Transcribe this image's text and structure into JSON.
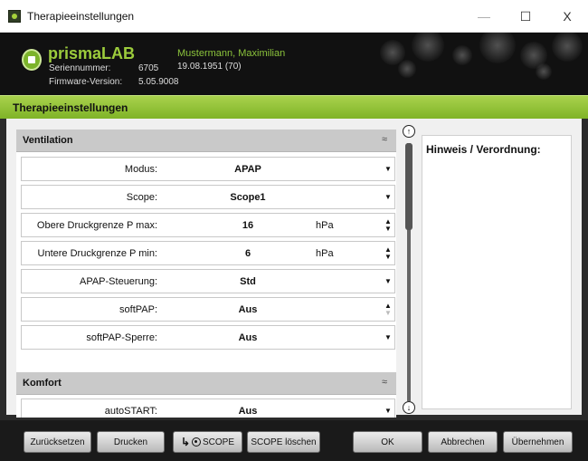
{
  "window": {
    "title": "Therapieeinstellungen",
    "min_glyph": "—",
    "max_glyph": "☐",
    "close_glyph": "X"
  },
  "header": {
    "brand": "prismaLAB",
    "serial_label": "Seriennummer:",
    "serial_value": "6705",
    "firmware_label": "Firmware-Version:",
    "firmware_value": "5.05.9008",
    "patient_name": "Mustermann, Maximilian",
    "patient_dob": "19.08.1951  (70)"
  },
  "section": {
    "title": "Therapieeinstellungen"
  },
  "groups": [
    {
      "title": "Ventilation",
      "collapse_glyph": "≈"
    },
    {
      "title": "Komfort",
      "collapse_glyph": "≈"
    }
  ],
  "rows": [
    {
      "label": "Modus:",
      "value": "APAP",
      "unit": "",
      "control": "dropdown"
    },
    {
      "label": "Scope:",
      "value": "Scope1",
      "unit": "",
      "control": "dropdown"
    },
    {
      "label": "Obere Druckgrenze P max:",
      "value": "16",
      "unit": "hPa",
      "control": "spinner"
    },
    {
      "label": "Untere Druckgrenze P min:",
      "value": "6",
      "unit": "hPa",
      "control": "spinner"
    },
    {
      "label": "APAP-Steuerung:",
      "value": "Std",
      "unit": "",
      "control": "dropdown"
    },
    {
      "label": "softPAP:",
      "value": "Aus",
      "unit": "",
      "control": "spinner"
    },
    {
      "label": "softPAP-Sperre:",
      "value": "Aus",
      "unit": "",
      "control": "dropdown"
    },
    {
      "label": "autoSTART:",
      "value": "Aus",
      "unit": "",
      "control": "dropdown"
    }
  ],
  "glyphs": {
    "dropdown": "▼",
    "up": "▲",
    "down": "▼",
    "scroll_up": "↑",
    "scroll_down": "↓",
    "scope_arrow": "↳"
  },
  "notes": {
    "title": "Hinweis / Verordnung:"
  },
  "footer": {
    "reset": "Zurücksetzen",
    "print": "Drucken",
    "scope": "SCOPE",
    "scope_delete": "SCOPE löschen",
    "ok": "OK",
    "cancel": "Abbrechen",
    "apply": "Übernehmen"
  },
  "colors": {
    "accent_green": "#8cc43c",
    "section_bar": "#a9d24d",
    "header_bg": "#111111"
  }
}
